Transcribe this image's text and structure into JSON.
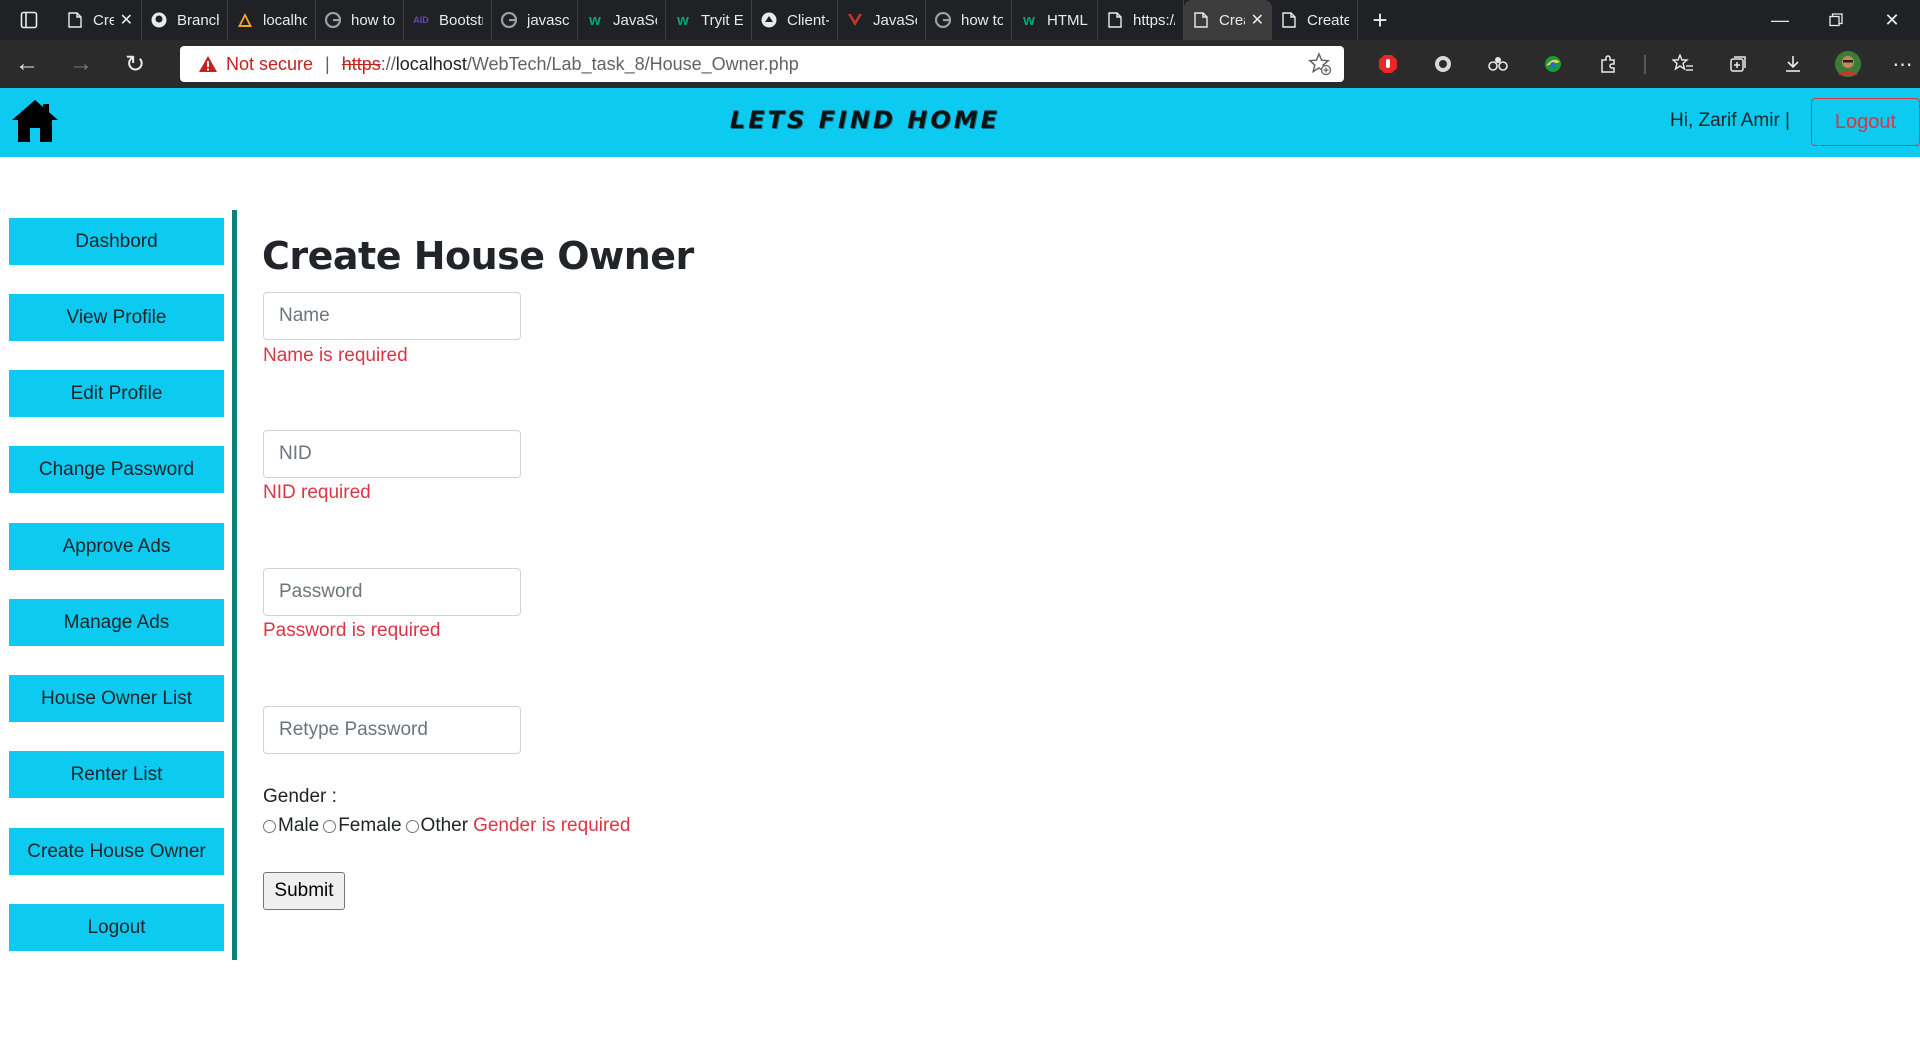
{
  "browser": {
    "tabs": [
      {
        "label": "Cre",
        "favicon": "page-icon",
        "active": false,
        "closable": true
      },
      {
        "label": "Branches",
        "favicon": "github-icon",
        "active": false
      },
      {
        "label": "localhost",
        "favicon": "xampp-icon",
        "active": false
      },
      {
        "label": "how to a",
        "favicon": "google-icon",
        "active": false
      },
      {
        "label": "Bootstrap",
        "favicon": "bootstrap-icon",
        "active": false
      },
      {
        "label": "javascript",
        "favicon": "google-icon",
        "active": false
      },
      {
        "label": "JavaScrip",
        "favicon": "w3schools-icon",
        "active": false
      },
      {
        "label": "Tryit Edit",
        "favicon": "w3schools-icon",
        "active": false
      },
      {
        "label": "Client-sic",
        "favicon": "mdn-icon",
        "active": false
      },
      {
        "label": "JavaScrip",
        "favicon": "vue-icon",
        "active": false
      },
      {
        "label": "how to li",
        "favicon": "google-icon",
        "active": false
      },
      {
        "label": "HTML sc",
        "favicon": "w3schools-icon",
        "active": false
      },
      {
        "label": "https://lo",
        "favicon": "page-icon",
        "active": false
      },
      {
        "label": "Crea",
        "favicon": "page-icon",
        "active": true,
        "closable": true
      },
      {
        "label": "Create H",
        "favicon": "page-icon",
        "active": false
      }
    ],
    "security_label": "Not secure",
    "url_scheme": "https",
    "url_sep": "://",
    "url_host": "localhost",
    "url_path": "/WebTech/Lab_task_8/House_Owner.php"
  },
  "header": {
    "brand": "LETS FIND HOME",
    "greeting": "Hi, Zarif Amir |",
    "logout": "Logout",
    "accent": "#0dcaf0"
  },
  "sidebar": {
    "items": [
      {
        "label": "Dashbord"
      },
      {
        "label": "View Profile"
      },
      {
        "label": "Edit Profile"
      },
      {
        "label": "Change Password"
      },
      {
        "label": "Approve Ads"
      },
      {
        "label": "Manage Ads"
      },
      {
        "label": "House Owner List"
      },
      {
        "label": "Renter List"
      },
      {
        "label": "Create House Owner"
      },
      {
        "label": "Logout"
      }
    ]
  },
  "form": {
    "title": "Create House Owner",
    "name_placeholder": "Name",
    "name_value": "",
    "name_error": "Name is required",
    "nid_placeholder": "NID",
    "nid_value": "",
    "nid_error": "NID required",
    "password_placeholder": "Password",
    "password_value": "",
    "password_error": "Password is required",
    "retype_placeholder": "Retype Password",
    "retype_value": "",
    "gender_label": "Gender :",
    "gender_options": [
      "Male",
      "Female",
      "Other"
    ],
    "gender_error": "Gender is required",
    "submit": "Submit",
    "error_color": "#dc3545"
  }
}
